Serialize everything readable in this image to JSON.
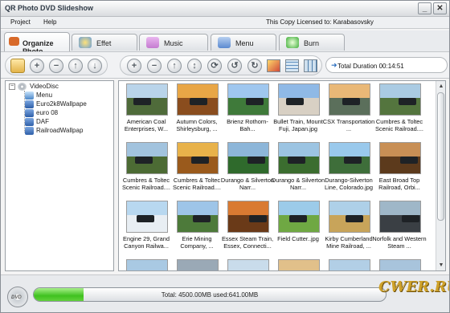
{
  "window": {
    "title": "QR Photo DVD Slideshow",
    "controls": {
      "minimize": "_",
      "close": "✕"
    }
  },
  "menu": {
    "items": [
      "Project",
      "Help"
    ],
    "license": "This Copy Licensed to: Karabasovsky"
  },
  "tabs": [
    {
      "label": "Organize Photo",
      "icon": "organize-photo-icon",
      "color": "#d86a2a",
      "active": true
    },
    {
      "label": "Effet",
      "icon": "effect-icon",
      "color": "#6a9fd8",
      "active": false
    },
    {
      "label": "Music",
      "icon": "music-icon",
      "color": "#c47bd0",
      "active": false
    },
    {
      "label": "Menu",
      "icon": "menu-icon",
      "color": "#5a8ad0",
      "active": false
    },
    {
      "label": "Burn",
      "icon": "burn-icon",
      "color": "#3fae3a",
      "active": false
    }
  ],
  "toolbar": {
    "duration_label": "Total Duration 00:14:51"
  },
  "tree": {
    "root": "VideoDisc",
    "children": [
      "Menu",
      "Euro2k8Wallpape",
      "euro 08",
      "DAF",
      "RailroadWallpap"
    ]
  },
  "photos": [
    {
      "caption": "American Coal Enterprises, W...",
      "sky": "#b9d4ea",
      "ground": "#4f6b3a"
    },
    {
      "caption": "Autumn Colors, Shirleysburg, ...",
      "sky": "#e8a646",
      "ground": "#8a4d1e"
    },
    {
      "caption": "Brienz Rothorn-Bah...",
      "sky": "#9fc7ef",
      "ground": "#3f7a3a"
    },
    {
      "caption": "Bullet Train, Mount Fuji, Japan.jpg",
      "sky": "#8fb9e6",
      "ground": "#d8d0c4"
    },
    {
      "caption": "CSX Transportation ...",
      "sky": "#e9b877",
      "ground": "#5b6f5b"
    },
    {
      "caption": "Cumbres & Toltec Scenic Railroad....",
      "sky": "#aacbe3",
      "ground": "#54753e"
    },
    {
      "caption": "Cumbres & Toltec Scenic Railroad....",
      "sky": "#a2c3de",
      "ground": "#4c6b34"
    },
    {
      "caption": "Cumbres & Toltec Scenic Railroad....",
      "sky": "#e8b24a",
      "ground": "#9a5a1c"
    },
    {
      "caption": "Durango & Silverton Narr...",
      "sky": "#8db6d9",
      "ground": "#2f6a2c"
    },
    {
      "caption": "Durango & Silverton Narr...",
      "sky": "#9cc4e2",
      "ground": "#3b6d2f"
    },
    {
      "caption": "Durango-Silverton Line, Colorado.jpg",
      "sky": "#9ac9ec",
      "ground": "#3e6e3a"
    },
    {
      "caption": "East Broad Top Railroad, Orbi...",
      "sky": "#c88f55",
      "ground": "#5c3a1c"
    },
    {
      "caption": "Engine 29, Grand Canyon Railwa...",
      "sky": "#b8d8f0",
      "ground": "#e8eef3"
    },
    {
      "caption": "Erie Mining Company, ...",
      "sky": "#9ec5e8",
      "ground": "#4d7a3a"
    },
    {
      "caption": "Essex Steam Train, Essex, Connecti...",
      "sky": "#d97a32",
      "ground": "#6a3a18"
    },
    {
      "caption": "Field Cutter..jpg",
      "sky": "#9ccbe9",
      "ground": "#6fa843"
    },
    {
      "caption": "Kirby Cumberland Mine Railroad, ...",
      "sky": "#aed0e8",
      "ground": "#c8a45a"
    },
    {
      "caption": "Norfolk and Western Steam ...",
      "sky": "#9fb7c8",
      "ground": "#3a3f44"
    },
    {
      "caption": "",
      "sky": "#a9c9e3",
      "ground": "#556b44"
    },
    {
      "caption": "",
      "sky": "#9aa9b6",
      "ground": "#2f3a40"
    },
    {
      "caption": "",
      "sky": "#c9dceb",
      "ground": "#5c7a4c"
    },
    {
      "caption": "",
      "sky": "#e1c08a",
      "ground": "#6a4e2a"
    },
    {
      "caption": "",
      "sky": "#b2cfe6",
      "ground": "#3c5e3a"
    },
    {
      "caption": "",
      "sky": "#a8c4dc",
      "ground": "#4a6a46"
    }
  ],
  "status": {
    "disc_label": "DVD",
    "usage_text": "Total: 4500.00MB used:641.00MB",
    "used_fraction": 0.1424,
    "logo": "CWER.RU"
  }
}
